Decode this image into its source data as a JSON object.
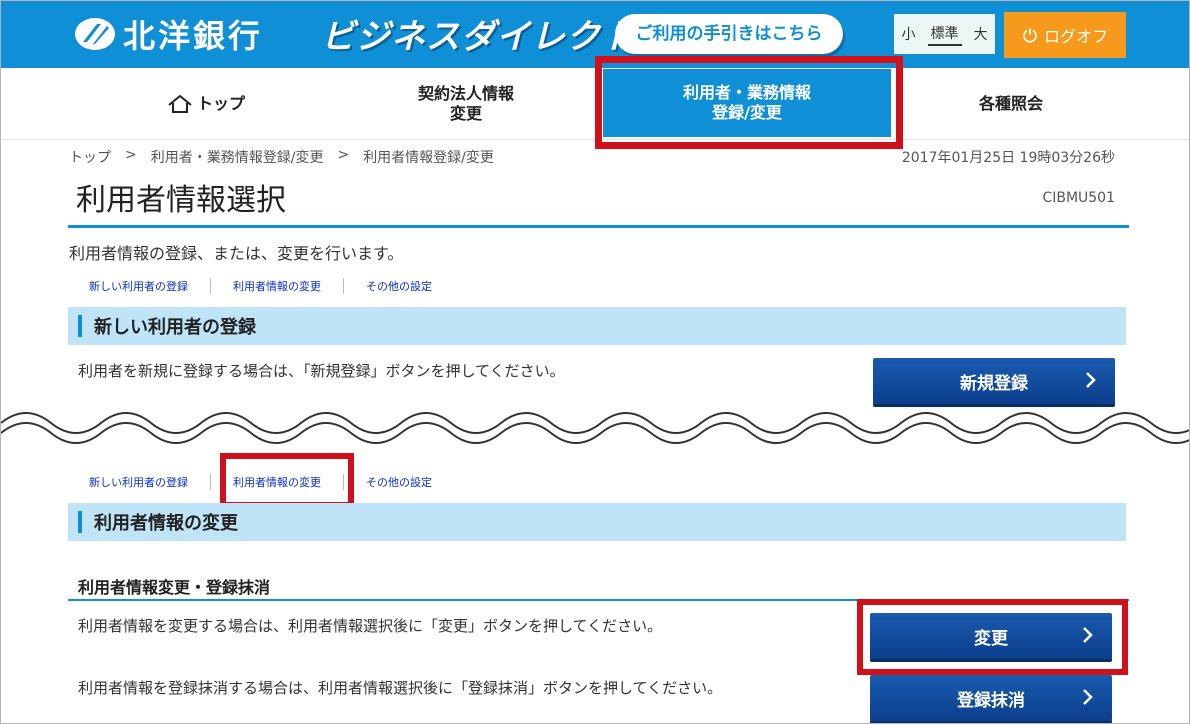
{
  "header": {
    "bank_name": "北洋銀行",
    "service_name": "ビジネスダイレクト",
    "guide_button": "ご利用の手引きはこちら",
    "font_size": {
      "small": "小",
      "standard": "標準",
      "large": "大"
    },
    "logoff": "ログオフ",
    "colors": {
      "brand": "#0f8fd6",
      "logoff": "#f59a1a",
      "highlight": "#d0101b"
    }
  },
  "nav": {
    "top": "トップ",
    "contract_line1": "契約法人情報",
    "contract_line2": "変更",
    "user_line1": "利用者・業務情報",
    "user_line2": "登録/変更",
    "inquiry": "各種照会"
  },
  "breadcrumb": {
    "items": [
      "トップ",
      ">",
      "利用者・業務情報登録/変更",
      ">",
      "利用者情報登録/変更"
    ]
  },
  "timestamp": "2017年01月25日 19時03分26秒",
  "page_title": "利用者情報選択",
  "screen_id": "CIBMU501",
  "intro": "利用者情報の登録、または、変更を行います。",
  "anchor_links": [
    "新しい利用者の登録",
    "利用者情報の変更",
    "その他の設定"
  ],
  "section_new": {
    "title": "新しい利用者の登録",
    "description": "利用者を新規に登録する場合は、「新規登録」ボタンを押してください。",
    "button": "新規登録"
  },
  "section_change": {
    "title": "利用者情報の変更",
    "subheading": "利用者情報変更・登録抹消",
    "change_description": "利用者情報を変更する場合は、利用者情報選択後に「変更」ボタンを押してください。",
    "change_button": "変更",
    "delete_description": "利用者情報を登録抹消する場合は、利用者情報選択後に「登録抹消」ボタンを押してください。",
    "delete_button": "登録抹消"
  }
}
